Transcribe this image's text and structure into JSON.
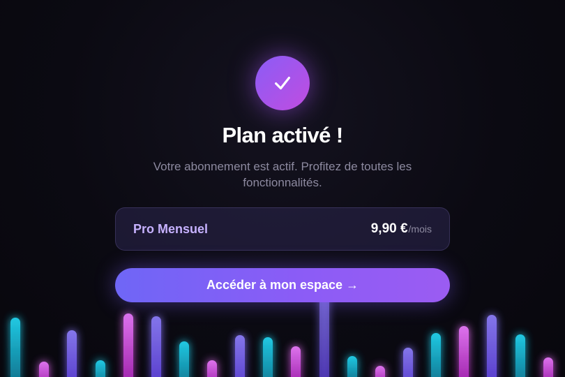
{
  "success": {
    "icon": "check-icon",
    "title": "Plan activé !",
    "subtitle": "Votre abonnement est actif. Profitez de toutes les fonctionnalités."
  },
  "plan": {
    "name": "Pro Mensuel",
    "price": "9,90 €",
    "period": "/mois"
  },
  "cta": {
    "label": "Accéder à mon espace →"
  },
  "colors": {
    "background": "#0b0a12",
    "accent": "#8b5cf6",
    "accent_pink": "#c04de0",
    "plan_name": "#c7b2ff",
    "muted_text": "#8d8aa0",
    "bar_cyan": "#14b8c8",
    "bar_magenta": "#d946ef",
    "bar_violet": "#7c5ce6"
  }
}
